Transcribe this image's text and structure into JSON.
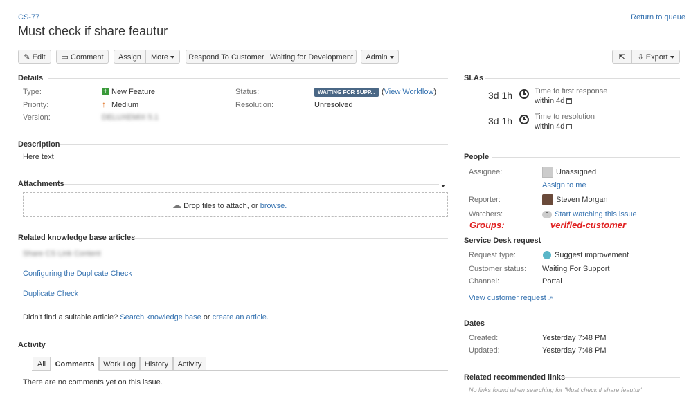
{
  "issue": {
    "key": "CS-77",
    "summary": "Must check if share feautur",
    "return_link": "Return to queue"
  },
  "toolbar": {
    "edit": "Edit",
    "comment": "Comment",
    "assign": "Assign",
    "more": "More",
    "respond": "Respond To Customer",
    "waiting_dev": "Waiting for Development",
    "admin": "Admin",
    "export": "Export"
  },
  "details": {
    "title": "Details",
    "type_label": "Type:",
    "type_value": "New Feature",
    "priority_label": "Priority:",
    "priority_value": "Medium",
    "version_label": "Version:",
    "version_value": "DELUXEMIX 5.1",
    "status_label": "Status:",
    "status_value": "WAITING FOR SUPP...",
    "view_workflow": "View Workflow",
    "resolution_label": "Resolution:",
    "resolution_value": "Unresolved"
  },
  "description": {
    "title": "Description",
    "text": "Here text"
  },
  "attachments": {
    "title": "Attachments",
    "drop_text": "Drop files to attach, or",
    "browse": "browse."
  },
  "kb": {
    "title": "Related knowledge base articles",
    "articles": [
      "Share CS Link Content",
      "Configuring the Duplicate Check",
      "Duplicate Check"
    ],
    "not_found_prefix": "Didn't find a suitable article?",
    "search_link": "Search knowledge base",
    "or": "or",
    "create_link": "create an article."
  },
  "activity": {
    "title": "Activity",
    "tabs": [
      "All",
      "Comments",
      "Work Log",
      "History",
      "Activity"
    ],
    "active_tab": "Comments",
    "empty_text": "There are no comments yet on this issue."
  },
  "slas": {
    "title": "SLAs",
    "items": [
      {
        "time": "3d 1h",
        "name": "Time to first response",
        "within": "within 4d"
      },
      {
        "time": "3d 1h",
        "name": "Time to resolution",
        "within": "within 4d"
      }
    ]
  },
  "people": {
    "title": "People",
    "assignee_label": "Assignee:",
    "assignee_value": "Unassigned",
    "assign_to_me": "Assign to me",
    "reporter_label": "Reporter:",
    "reporter_value": "Steven Morgan",
    "watchers_label": "Watchers:",
    "watchers_count": "0",
    "watch_link": "Start watching this issue",
    "groups_note": "Groups:",
    "groups_value": "verified-customer"
  },
  "service_desk": {
    "title": "Service Desk request",
    "request_type_label": "Request type:",
    "request_type_value": "Suggest improvement",
    "customer_status_label": "Customer status:",
    "customer_status_value": "Waiting For Support",
    "channel_label": "Channel:",
    "channel_value": "Portal",
    "view_request": "View customer request"
  },
  "dates": {
    "title": "Dates",
    "created_label": "Created:",
    "created_value": "Yesterday 7:48 PM",
    "updated_label": "Updated:",
    "updated_value": "Yesterday 7:48 PM"
  },
  "recommended": {
    "title": "Related recommended links",
    "empty_text": "No links found when searching for 'Must check if share feautur'"
  },
  "colors": {
    "link": "#3572b0",
    "status_badge": "#4a6785",
    "annotation": "#e02020"
  }
}
